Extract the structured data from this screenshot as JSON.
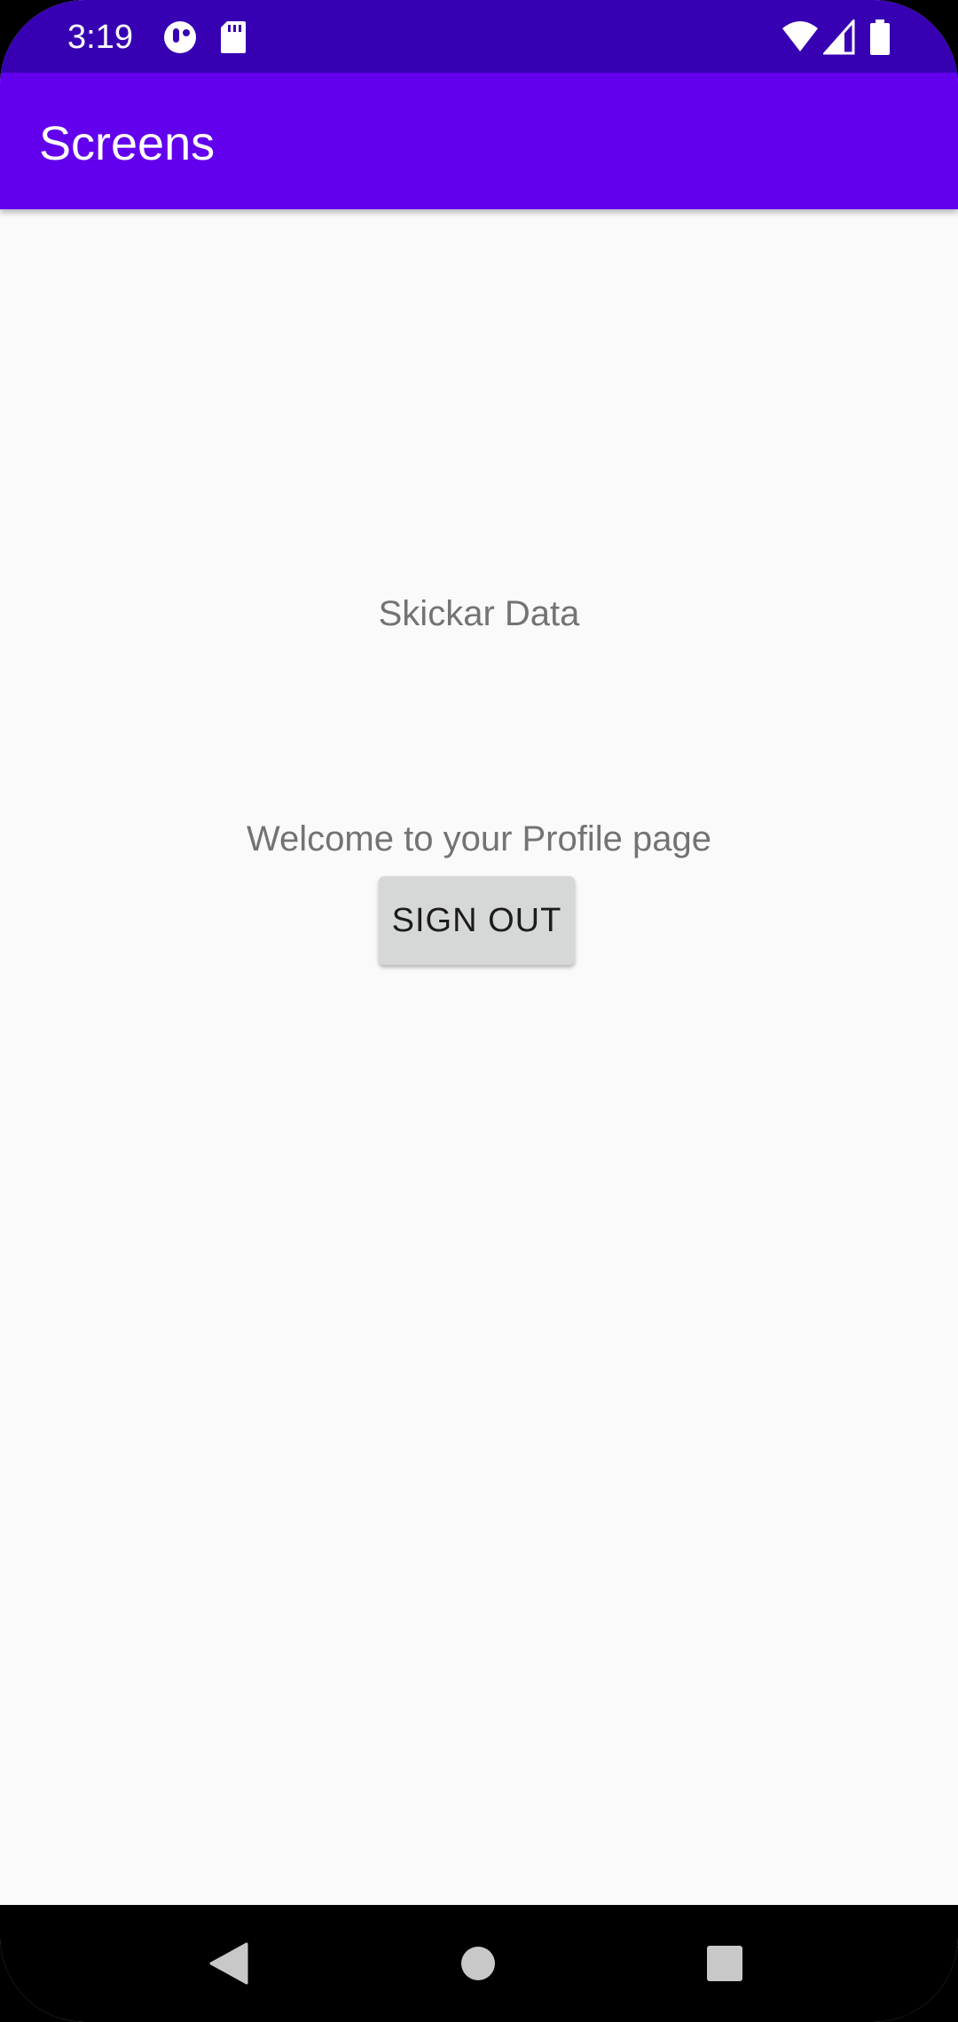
{
  "status_bar": {
    "time": "3:19",
    "background": "#3700B3",
    "left_icons": [
      "circle-indicator-icon",
      "sd-card-icon"
    ],
    "right_icons": [
      "wifi-icon",
      "cell-signal-icon",
      "battery-icon"
    ]
  },
  "app_bar": {
    "title": "Screens",
    "background": "#6200EE"
  },
  "main": {
    "data_label": "Skickar Data",
    "welcome_text": "Welcome to your Profile page",
    "sign_out_label": "SIGN OUT"
  },
  "nav_bar": {
    "icons": [
      "back-icon",
      "home-icon",
      "recents-icon"
    ]
  }
}
